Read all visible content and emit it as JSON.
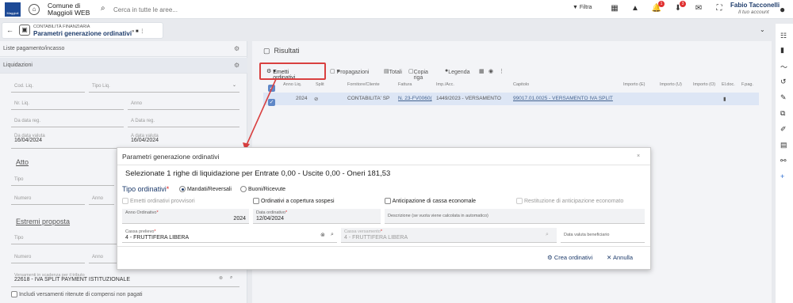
{
  "topbar": {
    "logo_text": "Maggioli",
    "org_name": "Comune di Maggioli WEB",
    "search_placeholder": "Cerca in tutte le aree...",
    "filter_label": "Filtra",
    "notifications_badge": "1",
    "downloads_badge": "3",
    "user_name": "Fabio Tacconelli",
    "user_account": "Il tuo account"
  },
  "breadcrumb": {
    "section": "CONTABILITÀ FINANZIARIA",
    "title": "Parametri generazione ordinativi",
    "actions": "»  ■  ⋮"
  },
  "left_panel": {
    "row1": "Liste pagamento/incasso",
    "row2": "Liquidazioni",
    "cod_liq": "Cod. Liq.",
    "tipo_liq": "Tipo Liq.",
    "nr_liq": "Nr. Liq.",
    "anno": "Anno",
    "da_data_reg": "Da data reg.",
    "a_data_reg": "A Data reg.",
    "da_data_valuta": "Da data valuta",
    "da_data_valuta_val": "16/04/2024",
    "a_data_valuta": "A data valuta",
    "a_data_valuta_val": "16/04/2024",
    "atto_title": "Atto",
    "tipo": "Tipo",
    "numero": "Numero",
    "anno2": "Anno",
    "estremi_title": "Estremi proposta",
    "tipo2": "Tipo",
    "numero2": "Numero",
    "anno3": "Anno",
    "versamenti_label": "Versamenti in scadenza per il tributo",
    "versamenti_value": "22618 - IVA SPLIT PAYMENT ISTITUZIONALE",
    "includi_label": "Includi versamenti ritenute di compensi non pagati"
  },
  "results": {
    "title": "Risultati",
    "toolbar": {
      "emetti": "Emetti ordinativi",
      "propagazioni": "Propagazioni",
      "totali": "Totali",
      "copia_riga": "Copia riga",
      "legenda": "Legenda"
    },
    "columns": [
      "Anno Liq.",
      "Split",
      "Fornitore/Cliente",
      "Fattura",
      "Imp./Acc.",
      "Capitolo",
      "Importo (E)",
      "Importo (U)",
      "Importo (O)",
      "El.doc.",
      "F.pag."
    ],
    "row": {
      "anno": "2024",
      "fornitore": "CONTABILITA' SP",
      "fattura": "N. 23-FV0060(",
      "imp": "1449/2023 - VERSAMENTO",
      "capitolo": "99017.01.0025 - VERSAMENTO IVA SPLIT"
    }
  },
  "modal": {
    "title": "Parametri generazione ordinativi",
    "close": "×",
    "subtitle": "Selezionate 1 righe di liquidazione per Entrate 0,00 - Uscite 0,00 - Oneri 181,53",
    "tipo_label": "Tipo ordinativi",
    "radio_mandati": "Mandati/Reversali",
    "radio_buoni": "Buoni/Ricevute",
    "cb_provvisori": "Emetti ordinativi provvisori",
    "cb_sospesi": "Ordinativi a copertura sospesi",
    "cb_anticipazione": "Anticipazione di cassa economale",
    "cb_restituzione": "Restituzione di anticipazione economato",
    "anno_label": "Anno Ordinativo",
    "anno_value": "2024",
    "data_label": "Data ordinativo",
    "data_value": "12/04/2024",
    "descrizione_label": "Descrizione (se vuota viene calcolata in automatico)",
    "cassa_prelievo_label": "Cassa prelievo",
    "cassa_prelievo_value": "4 - FRUTTIFERA LIBERA",
    "cassa_versamento_label": "Cassa versamento",
    "cassa_versamento_value": "4 - FRUTTIFERA LIBERA",
    "data_valuta_label": "Data valuta beneficiario",
    "btn_crea": "Crea ordinativi",
    "btn_annulla": "Annulla"
  },
  "colors": {
    "accent": "#1d3b6b",
    "highlight": "#d94040",
    "selected_row": "#dde6f5"
  }
}
